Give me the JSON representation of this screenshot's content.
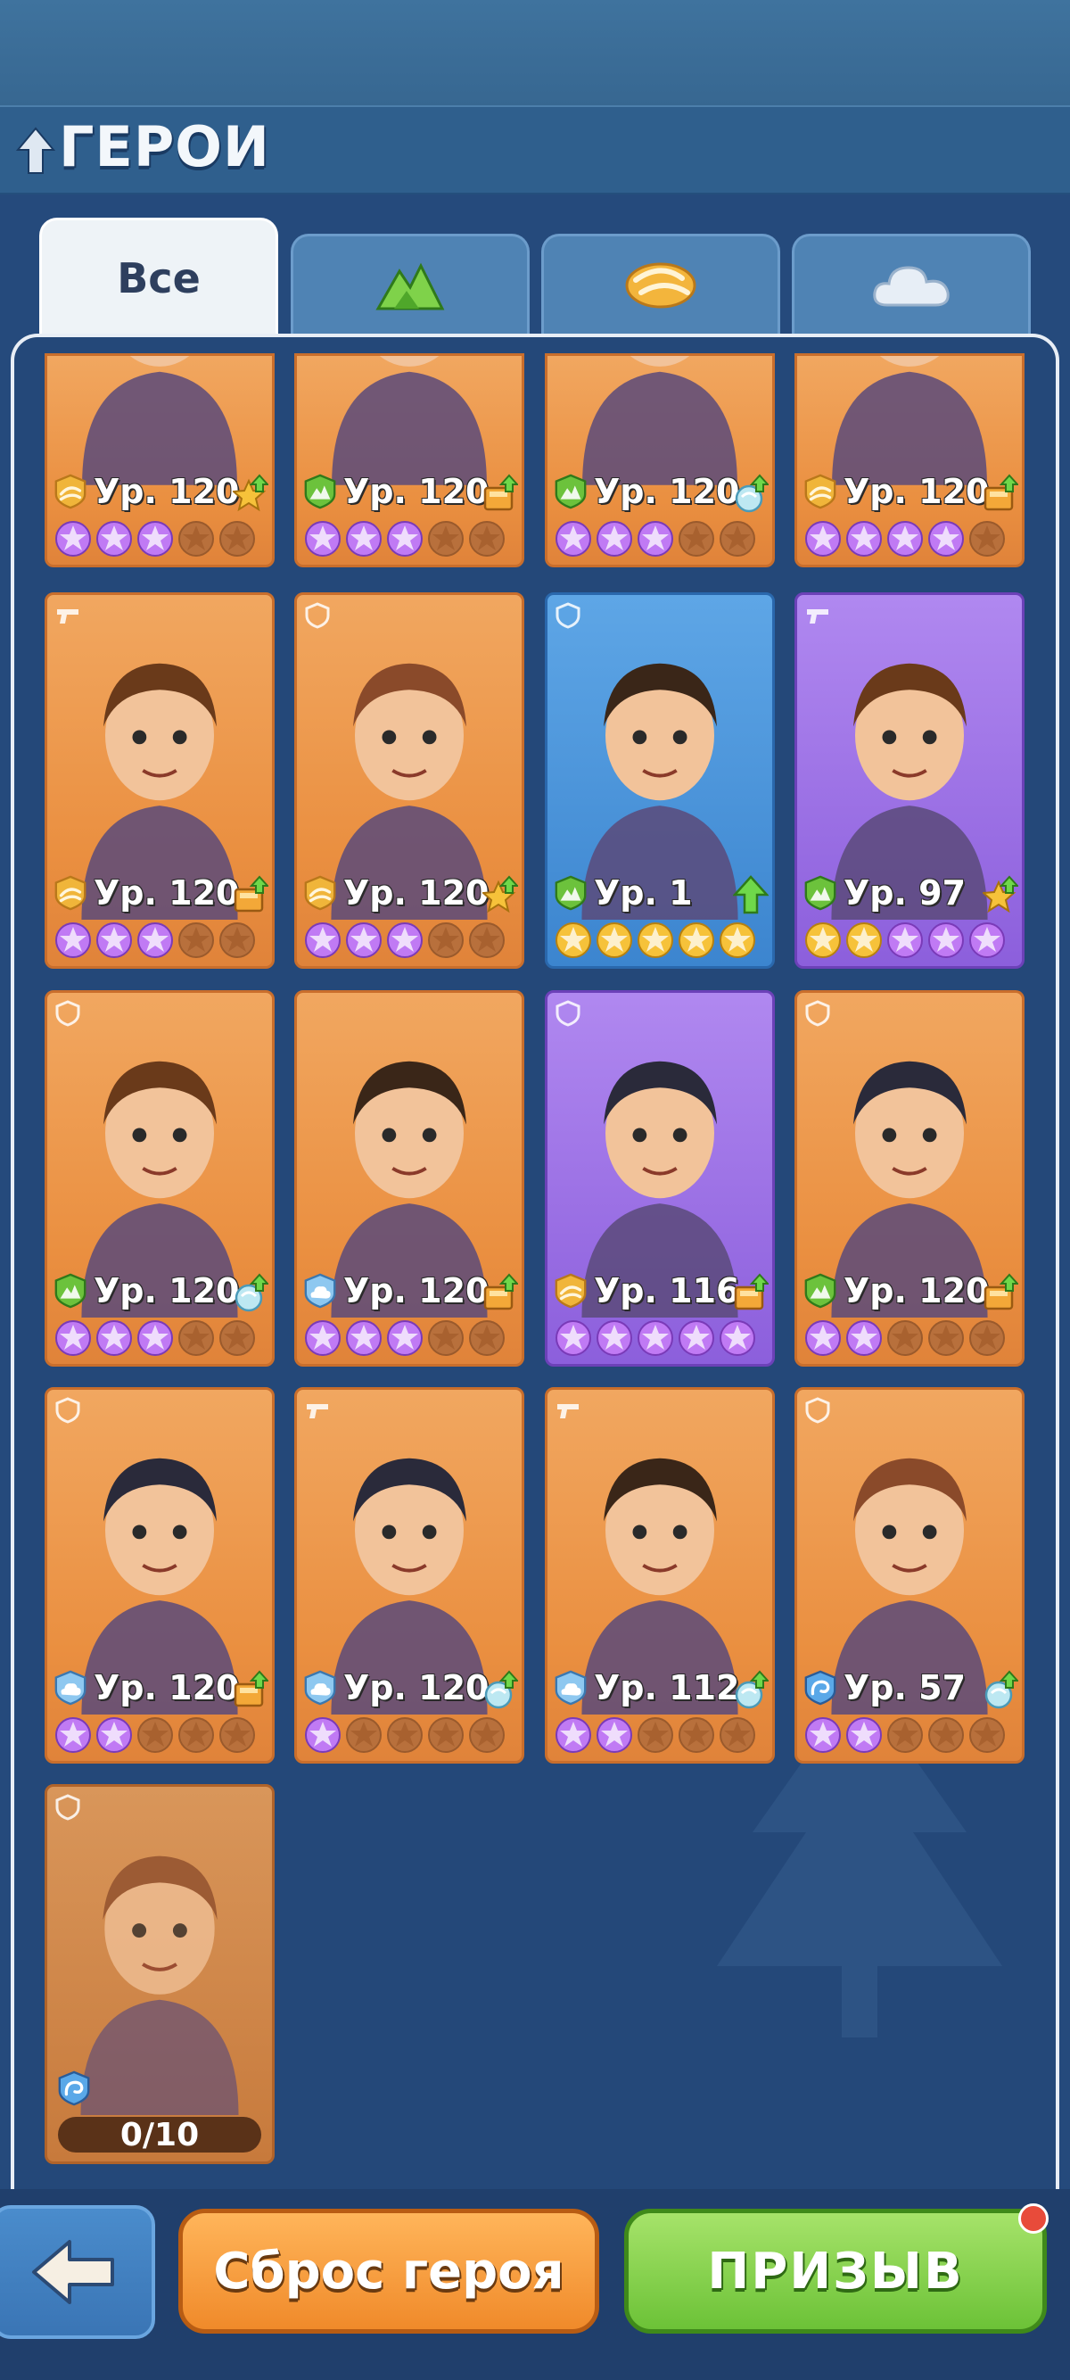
{
  "header": {
    "title": "ГЕРОИ"
  },
  "tabs": [
    {
      "label": "Все",
      "icon": "all",
      "active": true
    },
    {
      "label": "",
      "icon": "mountain-icon",
      "active": false
    },
    {
      "label": "",
      "icon": "wind-icon",
      "active": false
    },
    {
      "label": "",
      "icon": "cloud-icon",
      "active": false
    }
  ],
  "heroes": [
    {
      "level": "Ур. 120",
      "element": "sand",
      "bg": "orange",
      "tag": "",
      "stars": {
        "gold": 0,
        "purple": 3,
        "empty": 2
      },
      "up": "star",
      "cropped": true
    },
    {
      "level": "Ур. 120",
      "element": "mountain",
      "bg": "orange",
      "tag": "",
      "stars": {
        "gold": 0,
        "purple": 3,
        "empty": 2
      },
      "up": "book",
      "cropped": true
    },
    {
      "level": "Ур. 120",
      "element": "mountain",
      "bg": "orange",
      "tag": "",
      "stars": {
        "gold": 0,
        "purple": 3,
        "empty": 2
      },
      "up": "crystal",
      "cropped": true
    },
    {
      "level": "Ур. 120",
      "element": "sand",
      "bg": "orange",
      "tag": "",
      "stars": {
        "gold": 0,
        "purple": 4,
        "empty": 1
      },
      "up": "book",
      "cropped": true
    },
    {
      "level": "Ур. 120",
      "element": "sand",
      "bg": "orange",
      "tag": "gun",
      "stars": {
        "gold": 0,
        "purple": 3,
        "empty": 2
      },
      "up": "book"
    },
    {
      "level": "Ур. 120",
      "element": "sand",
      "bg": "orange",
      "tag": "shield",
      "stars": {
        "gold": 0,
        "purple": 3,
        "empty": 2
      },
      "up": "star"
    },
    {
      "level": "Ур. 1",
      "element": "mountain",
      "bg": "blue",
      "tag": "shield",
      "stars": {
        "gold": 5,
        "purple": 0,
        "empty": 0
      },
      "up": "arrow"
    },
    {
      "level": "Ур. 97",
      "element": "mountain",
      "bg": "purple",
      "tag": "gun",
      "stars": {
        "gold": 2,
        "purple": 3,
        "empty": 0
      },
      "up": "star"
    },
    {
      "level": "Ур. 120",
      "element": "mountain",
      "bg": "orange",
      "tag": "shield",
      "stars": {
        "gold": 0,
        "purple": 3,
        "empty": 2
      },
      "up": "crystal"
    },
    {
      "level": "Ур. 120",
      "element": "cloud",
      "bg": "orange",
      "tag": "",
      "stars": {
        "gold": 0,
        "purple": 3,
        "empty": 2
      },
      "up": "book"
    },
    {
      "level": "Ур. 116",
      "element": "sand",
      "bg": "purple",
      "tag": "shield",
      "stars": {
        "gold": 0,
        "purple": 5,
        "empty": 0
      },
      "up": "book"
    },
    {
      "level": "Ур. 120",
      "element": "mountain",
      "bg": "orange",
      "tag": "shield",
      "stars": {
        "gold": 0,
        "purple": 2,
        "empty": 3
      },
      "up": "book"
    },
    {
      "level": "Ур. 120",
      "element": "cloud",
      "bg": "orange",
      "tag": "shield",
      "stars": {
        "gold": 0,
        "purple": 2,
        "empty": 3
      },
      "up": "book"
    },
    {
      "level": "Ур. 120",
      "element": "cloud",
      "bg": "orange",
      "tag": "gun",
      "stars": {
        "gold": 0,
        "purple": 1,
        "empty": 4
      },
      "up": "crystal"
    },
    {
      "level": "Ур. 112",
      "element": "cloud",
      "bg": "orange",
      "tag": "gun",
      "stars": {
        "gold": 0,
        "purple": 2,
        "empty": 3
      },
      "up": "crystal"
    },
    {
      "level": "Ур. 57",
      "element": "wave",
      "bg": "orange",
      "tag": "shield",
      "stars": {
        "gold": 0,
        "purple": 2,
        "empty": 3
      },
      "up": "crystal"
    }
  ],
  "locked_hero": {
    "progress": "0/10",
    "element": "wave",
    "tag": "shield"
  },
  "buttons": {
    "back": "back-arrow-icon",
    "reset": "Сброс героя",
    "summon": "ПРИЗЫВ"
  },
  "colors": {
    "card_orange": "#ea8f40",
    "card_blue": "#3c85cf",
    "card_purple": "#8c5fdc",
    "bg": "#254a7c",
    "star_purple": "#b36af0",
    "star_gold": "#f2c02c"
  }
}
